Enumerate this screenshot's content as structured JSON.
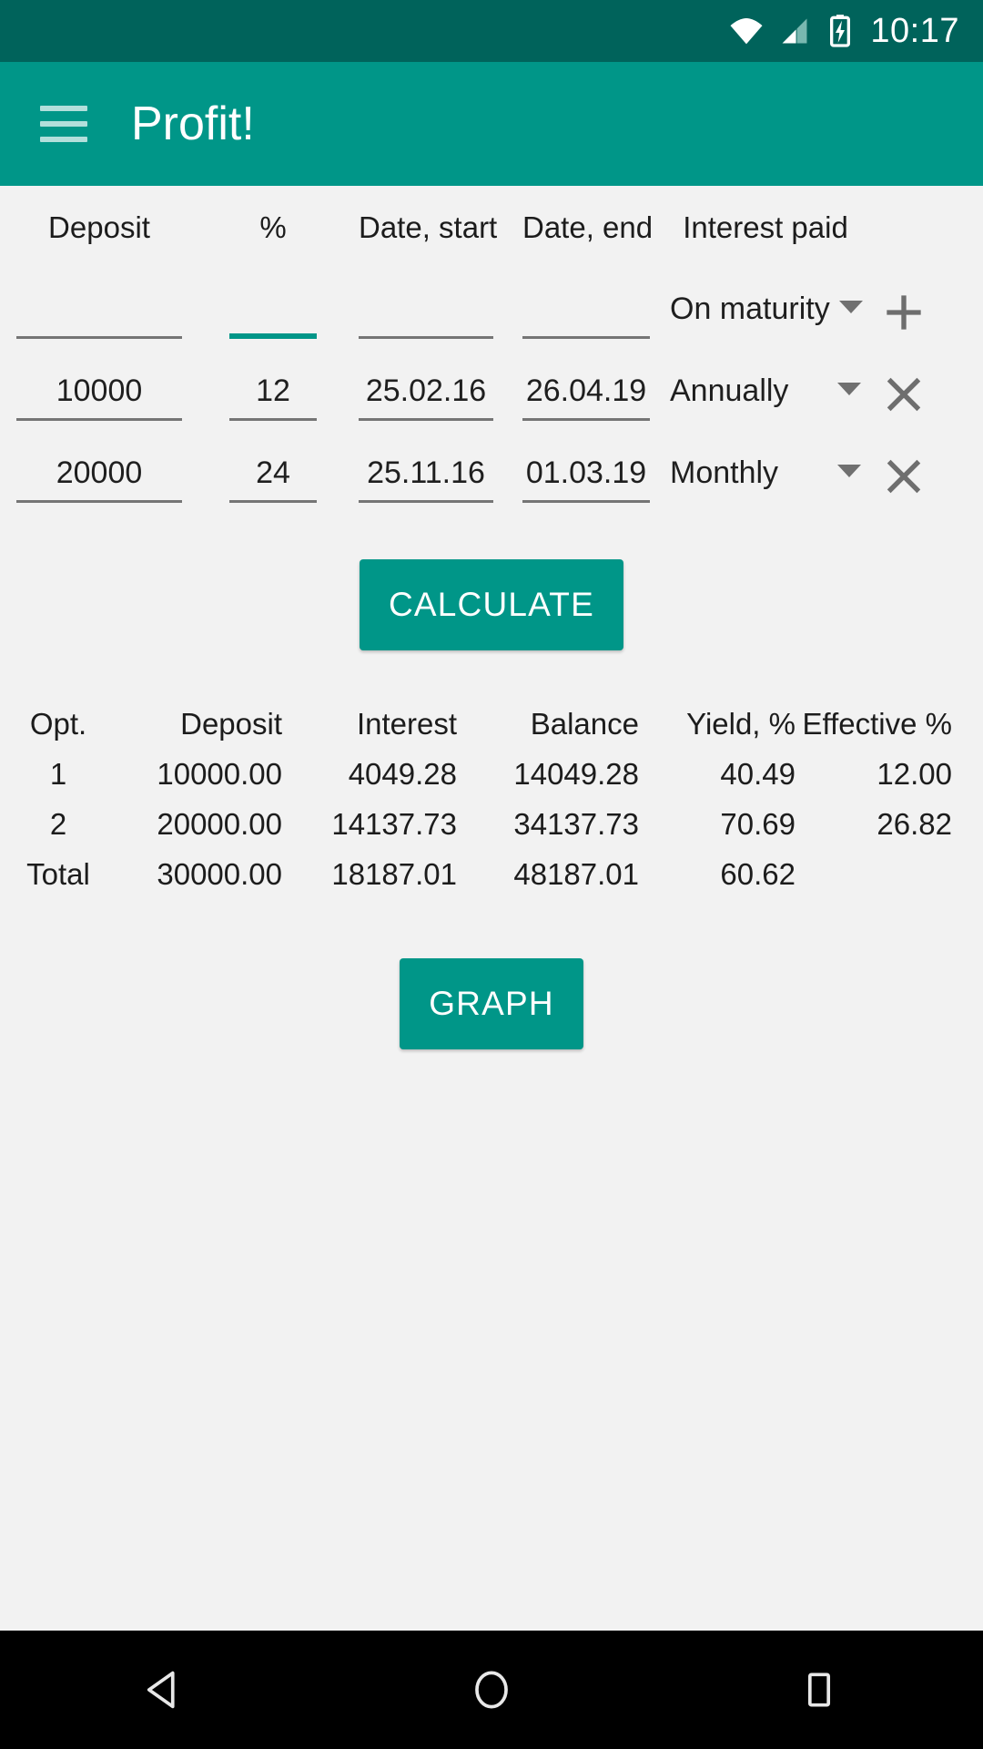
{
  "status_bar": {
    "clock": "10:17",
    "icons": [
      "wifi-icon",
      "cellular-signal-icon",
      "battery-charging-icon"
    ],
    "background": "#00635b"
  },
  "app_bar": {
    "title": "Profit!",
    "menu_icon": "hamburger-menu-icon",
    "background": "#009688"
  },
  "input_table": {
    "headers": [
      "Deposit",
      "%",
      "Date, start",
      "Date, end",
      "Interest paid"
    ],
    "new_row": {
      "deposit": "",
      "percent": "",
      "date_start": "",
      "date_end": "",
      "interest_paid": "On maturity",
      "add_label": "+",
      "focused_field": "percent"
    },
    "rows": [
      {
        "deposit": "10000",
        "percent": "12",
        "date_start": "25.02.16",
        "date_end": "26.04.19",
        "interest_paid": "Annually",
        "remove_label": "×"
      },
      {
        "deposit": "20000",
        "percent": "24",
        "date_start": "25.11.16",
        "date_end": "01.03.19",
        "interest_paid": "Monthly",
        "remove_label": "×"
      }
    ],
    "placeholders": {
      "deposit": "",
      "percent": "",
      "date_start": "",
      "date_end": ""
    }
  },
  "calculate_button": {
    "label": "CALCULATE",
    "color": "#009688"
  },
  "graph_button": {
    "label": "GRAPH",
    "color": "#009688"
  },
  "results_table": {
    "headers": [
      "Opt.",
      "Deposit",
      "Interest",
      "Balance",
      "Yield, %",
      "Effective %"
    ],
    "rows": [
      {
        "opt": "1",
        "deposit": "10000.00",
        "interest": "4049.28",
        "balance": "14049.28",
        "yield": "40.49",
        "effective": "12.00"
      },
      {
        "opt": "2",
        "deposit": "20000.00",
        "interest": "14137.73",
        "balance": "34137.73",
        "yield": "70.69",
        "effective": "26.82"
      },
      {
        "opt": "Total",
        "deposit": "30000.00",
        "interest": "18187.01",
        "balance": "48187.01",
        "yield": "60.62",
        "effective": ""
      }
    ]
  },
  "nav_bar": {
    "back": "back-triangle-icon",
    "home": "home-circle-icon",
    "recents": "recents-square-icon"
  }
}
